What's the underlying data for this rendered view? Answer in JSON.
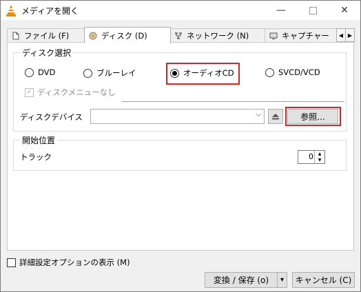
{
  "window": {
    "title": "メディアを開く",
    "minimize_symbol": "—",
    "close_symbol": "✕"
  },
  "tabs": [
    {
      "label": "ファイル (F)",
      "icon": "file-icon"
    },
    {
      "label": "ディスク (D)",
      "icon": "disc-icon"
    },
    {
      "label": "ネットワーク (N)",
      "icon": "network-icon"
    },
    {
      "label": "キャプチャー",
      "icon": "capture-icon"
    }
  ],
  "tab_scroll": {
    "left": "◀",
    "right": "▶"
  },
  "disc_selection": {
    "title": "ディスク選択",
    "options": [
      {
        "label": "DVD",
        "selected": false
      },
      {
        "label": "ブルーレイ",
        "selected": false
      },
      {
        "label": "オーディオCD",
        "selected": true
      },
      {
        "label": "SVCD/VCD",
        "selected": false
      }
    ],
    "no_menu_label": "ディスクメニューなし",
    "no_menu_checkmark": "✓",
    "device_label": "ディスクデバイス",
    "device_value": "",
    "dropdown_arrow": "⌵",
    "eject_icon": "eject-icon",
    "browse_label": "参照..."
  },
  "start_position": {
    "title": "開始位置",
    "track_label": "トラック",
    "track_value": "0",
    "spin_up": "▲",
    "spin_down": "▼"
  },
  "footer": {
    "advanced_label": "詳細設定オプションの表示 (M)",
    "convert_label": "変換 / 保存 (o)",
    "convert_arrow": "▾",
    "cancel_label": "キャンセル (C)"
  },
  "colors": {
    "highlight": "#e02020",
    "vlc_orange": "#f28b00"
  }
}
